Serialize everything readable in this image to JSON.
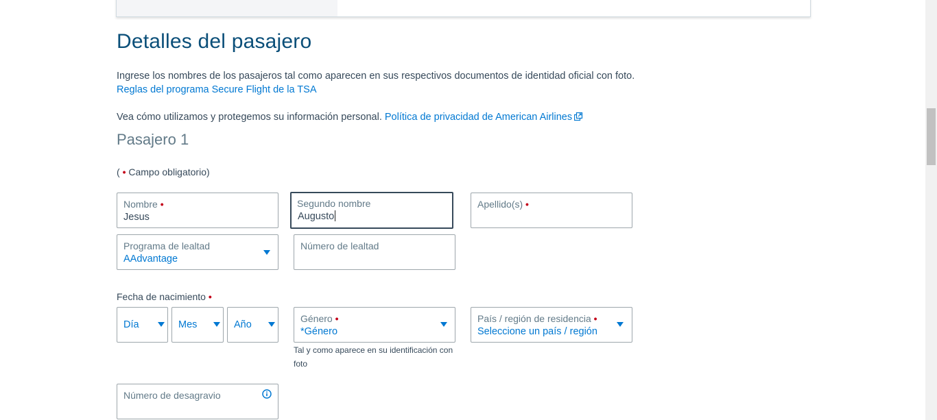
{
  "passenger_details": {
    "title": "Detalles del pasajero",
    "instructions": "Ingrese los nombres de los pasajeros tal como aparecen en sus respectivos documentos de identidad oficial con foto.",
    "tsa_link": "Reglas del programa Secure Flight de la TSA",
    "privacy_text": "Vea cómo utilizamos y protegemos su información personal.",
    "privacy_link": "Política de privacidad de American Airlines"
  },
  "passenger1": {
    "heading": "Pasajero 1",
    "required_note_open": "(",
    "required_dot": "•",
    "required_note_text": "Campo obligatorio)",
    "first_name": {
      "label": "Nombre",
      "value": "Jesus"
    },
    "middle_name": {
      "label": "Segundo nombre",
      "value": "Augusto"
    },
    "last_name": {
      "label": "Apellido(s)",
      "value": ""
    },
    "loyalty_program": {
      "label": "Programa de lealtad",
      "value": "AAdvantage"
    },
    "loyalty_number": {
      "label": "Número de lealtad",
      "value": ""
    },
    "dob": {
      "label": "Fecha de nacimiento",
      "day": "Día",
      "month": "Mes",
      "year": "Año"
    },
    "gender": {
      "label": "Género",
      "value": "*Género",
      "helper": "Tal y como aparece en su identificación con foto"
    },
    "country": {
      "label": "País / región de residencia",
      "value": "Seleccione un país / región"
    },
    "redress": {
      "label": "Número de desagravio"
    }
  },
  "colors": {
    "accent": "#0078d2",
    "title": "#0b4f79",
    "required": "#c30019",
    "text": "#36495a"
  }
}
